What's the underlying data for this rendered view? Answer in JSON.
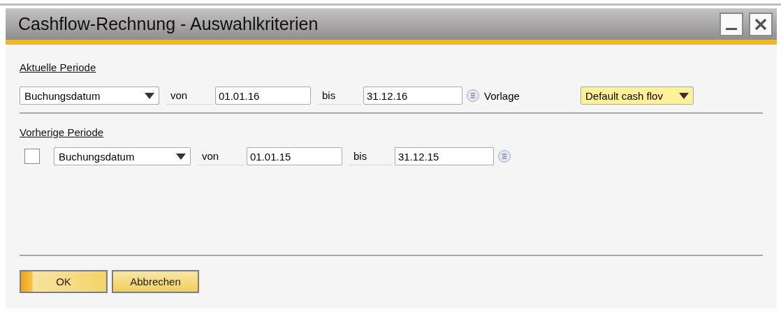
{
  "window": {
    "title": "Cashflow-Rechnung - Auswahlkriterien"
  },
  "current_period": {
    "label": "Aktuelle Periode",
    "date_type": "Buchungsdatum",
    "from_label": "von",
    "from": "01.01.16",
    "to_label": "bis",
    "to": "31.12.16",
    "template_label": "Vorlage",
    "template": "Default cash flov"
  },
  "previous_period": {
    "label": "Vorherige Periode",
    "checked": false,
    "date_type": "Buchungsdatum",
    "from_label": "von",
    "from": "01.01.15",
    "to_label": "bis",
    "to": "31.12.15"
  },
  "buttons": [
    {
      "label": "OK",
      "default": true
    },
    {
      "label": "Abbrechen",
      "default": false
    }
  ]
}
